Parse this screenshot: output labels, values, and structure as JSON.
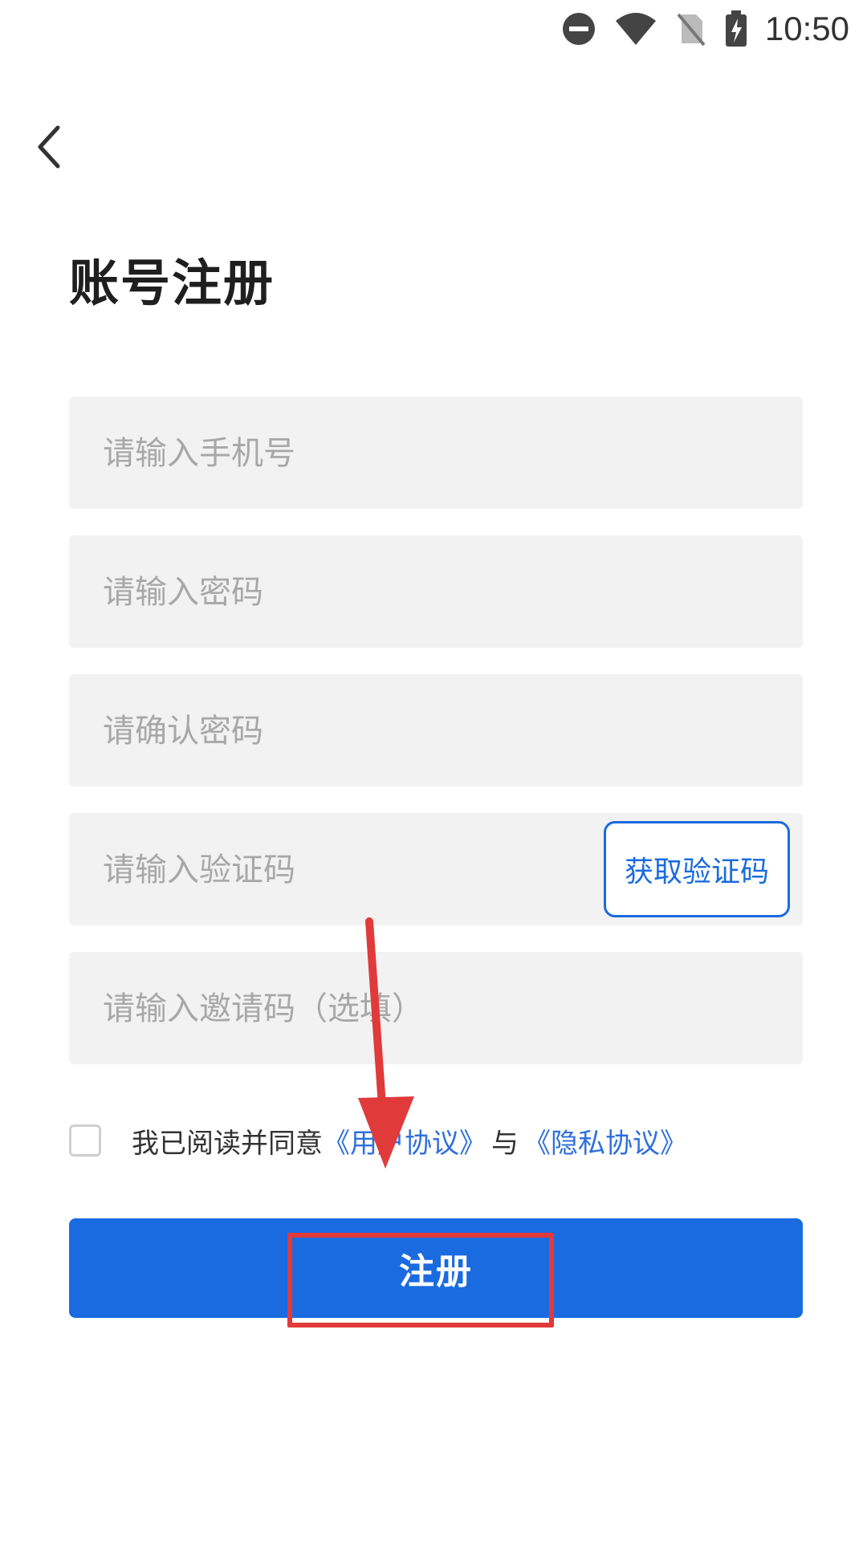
{
  "status_bar": {
    "time": "10:50",
    "icons": [
      "do-not-disturb-icon",
      "wifi-icon",
      "no-sim-icon",
      "battery-charging-icon"
    ]
  },
  "header": {
    "back_icon": "chevron-left-icon"
  },
  "page": {
    "title": "账号注册"
  },
  "form": {
    "phone_placeholder": "请输入手机号",
    "password_placeholder": "请输入密码",
    "confirm_password_placeholder": "请确认密码",
    "code_placeholder": "请输入验证码",
    "get_code_label": "获取验证码",
    "invite_placeholder": "请输入邀请码（选填）"
  },
  "agreement": {
    "prefix": "我已阅读并同意",
    "user_agreement": "《用户协议》",
    "joiner": "与",
    "privacy_agreement": "《隐私协议》",
    "checked": false
  },
  "actions": {
    "register_label": "注册"
  },
  "colors": {
    "primary": "#1a6be0",
    "link": "#2f6fdc",
    "field_bg": "#f2f2f2",
    "annotation": "#e03a3a"
  }
}
